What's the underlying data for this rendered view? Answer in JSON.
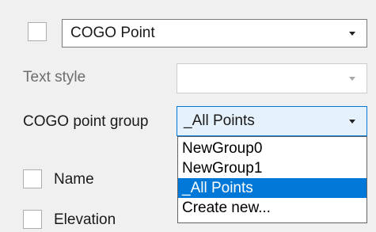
{
  "top": {
    "checkbox_checked": false,
    "combo_value": "COGO Point"
  },
  "text_style": {
    "label": "Text style",
    "combo_value": ""
  },
  "point_group": {
    "label": "COGO point group",
    "combo_value": "_All Points",
    "options": [
      "NewGroup0",
      "NewGroup1",
      "_All Points",
      "Create new..."
    ],
    "selected_index": 2
  },
  "name_row": {
    "label": "Name",
    "checked": false
  },
  "elevation_row": {
    "label": "Elevation",
    "checked": false
  },
  "colors": {
    "accent": "#0078d7",
    "highlight_bg": "#e5f1fb"
  }
}
